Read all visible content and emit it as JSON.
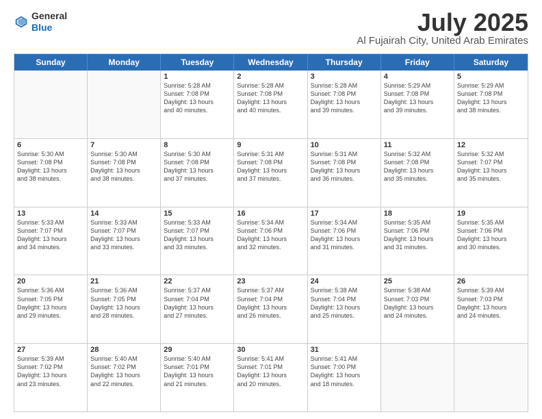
{
  "header": {
    "logo_line1": "General",
    "logo_line2": "Blue",
    "month": "July 2025",
    "location": "Al Fujairah City, United Arab Emirates"
  },
  "days_of_week": [
    "Sunday",
    "Monday",
    "Tuesday",
    "Wednesday",
    "Thursday",
    "Friday",
    "Saturday"
  ],
  "weeks": [
    [
      {
        "day": "",
        "info": ""
      },
      {
        "day": "",
        "info": ""
      },
      {
        "day": "1",
        "info": "Sunrise: 5:28 AM\nSunset: 7:08 PM\nDaylight: 13 hours\nand 40 minutes."
      },
      {
        "day": "2",
        "info": "Sunrise: 5:28 AM\nSunset: 7:08 PM\nDaylight: 13 hours\nand 40 minutes."
      },
      {
        "day": "3",
        "info": "Sunrise: 5:28 AM\nSunset: 7:08 PM\nDaylight: 13 hours\nand 39 minutes."
      },
      {
        "day": "4",
        "info": "Sunrise: 5:29 AM\nSunset: 7:08 PM\nDaylight: 13 hours\nand 39 minutes."
      },
      {
        "day": "5",
        "info": "Sunrise: 5:29 AM\nSunset: 7:08 PM\nDaylight: 13 hours\nand 38 minutes."
      }
    ],
    [
      {
        "day": "6",
        "info": "Sunrise: 5:30 AM\nSunset: 7:08 PM\nDaylight: 13 hours\nand 38 minutes."
      },
      {
        "day": "7",
        "info": "Sunrise: 5:30 AM\nSunset: 7:08 PM\nDaylight: 13 hours\nand 38 minutes."
      },
      {
        "day": "8",
        "info": "Sunrise: 5:30 AM\nSunset: 7:08 PM\nDaylight: 13 hours\nand 37 minutes."
      },
      {
        "day": "9",
        "info": "Sunrise: 5:31 AM\nSunset: 7:08 PM\nDaylight: 13 hours\nand 37 minutes."
      },
      {
        "day": "10",
        "info": "Sunrise: 5:31 AM\nSunset: 7:08 PM\nDaylight: 13 hours\nand 36 minutes."
      },
      {
        "day": "11",
        "info": "Sunrise: 5:32 AM\nSunset: 7:08 PM\nDaylight: 13 hours\nand 35 minutes."
      },
      {
        "day": "12",
        "info": "Sunrise: 5:32 AM\nSunset: 7:07 PM\nDaylight: 13 hours\nand 35 minutes."
      }
    ],
    [
      {
        "day": "13",
        "info": "Sunrise: 5:33 AM\nSunset: 7:07 PM\nDaylight: 13 hours\nand 34 minutes."
      },
      {
        "day": "14",
        "info": "Sunrise: 5:33 AM\nSunset: 7:07 PM\nDaylight: 13 hours\nand 33 minutes."
      },
      {
        "day": "15",
        "info": "Sunrise: 5:33 AM\nSunset: 7:07 PM\nDaylight: 13 hours\nand 33 minutes."
      },
      {
        "day": "16",
        "info": "Sunrise: 5:34 AM\nSunset: 7:06 PM\nDaylight: 13 hours\nand 32 minutes."
      },
      {
        "day": "17",
        "info": "Sunrise: 5:34 AM\nSunset: 7:06 PM\nDaylight: 13 hours\nand 31 minutes."
      },
      {
        "day": "18",
        "info": "Sunrise: 5:35 AM\nSunset: 7:06 PM\nDaylight: 13 hours\nand 31 minutes."
      },
      {
        "day": "19",
        "info": "Sunrise: 5:35 AM\nSunset: 7:06 PM\nDaylight: 13 hours\nand 30 minutes."
      }
    ],
    [
      {
        "day": "20",
        "info": "Sunrise: 5:36 AM\nSunset: 7:05 PM\nDaylight: 13 hours\nand 29 minutes."
      },
      {
        "day": "21",
        "info": "Sunrise: 5:36 AM\nSunset: 7:05 PM\nDaylight: 13 hours\nand 28 minutes."
      },
      {
        "day": "22",
        "info": "Sunrise: 5:37 AM\nSunset: 7:04 PM\nDaylight: 13 hours\nand 27 minutes."
      },
      {
        "day": "23",
        "info": "Sunrise: 5:37 AM\nSunset: 7:04 PM\nDaylight: 13 hours\nand 26 minutes."
      },
      {
        "day": "24",
        "info": "Sunrise: 5:38 AM\nSunset: 7:04 PM\nDaylight: 13 hours\nand 25 minutes."
      },
      {
        "day": "25",
        "info": "Sunrise: 5:38 AM\nSunset: 7:03 PM\nDaylight: 13 hours\nand 24 minutes."
      },
      {
        "day": "26",
        "info": "Sunrise: 5:39 AM\nSunset: 7:03 PM\nDaylight: 13 hours\nand 24 minutes."
      }
    ],
    [
      {
        "day": "27",
        "info": "Sunrise: 5:39 AM\nSunset: 7:02 PM\nDaylight: 13 hours\nand 23 minutes."
      },
      {
        "day": "28",
        "info": "Sunrise: 5:40 AM\nSunset: 7:02 PM\nDaylight: 13 hours\nand 22 minutes."
      },
      {
        "day": "29",
        "info": "Sunrise: 5:40 AM\nSunset: 7:01 PM\nDaylight: 13 hours\nand 21 minutes."
      },
      {
        "day": "30",
        "info": "Sunrise: 5:41 AM\nSunset: 7:01 PM\nDaylight: 13 hours\nand 20 minutes."
      },
      {
        "day": "31",
        "info": "Sunrise: 5:41 AM\nSunset: 7:00 PM\nDaylight: 13 hours\nand 18 minutes."
      },
      {
        "day": "",
        "info": ""
      },
      {
        "day": "",
        "info": ""
      }
    ]
  ]
}
